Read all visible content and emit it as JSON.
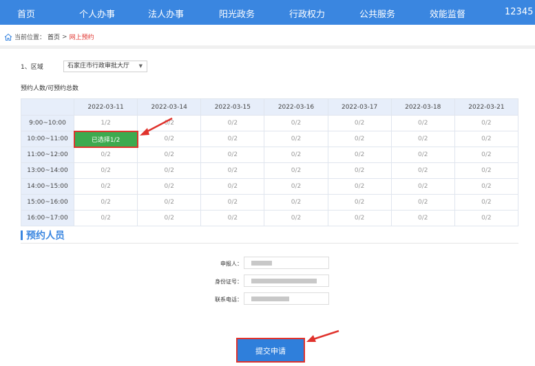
{
  "nav": {
    "items": [
      "首页",
      "个人办事",
      "法人办事",
      "阳光政务",
      "行政权力",
      "公共服务",
      "效能监督",
      "12345"
    ]
  },
  "breadcrumb": {
    "label": "当前位置：",
    "home": "首页",
    "separator": ">",
    "current": "网上预约"
  },
  "region": {
    "label": "1、区域",
    "selected": "石家庄市行政审批大厅"
  },
  "quota_label": "预约人数/可预约总数",
  "schedule": {
    "dates": [
      "2022-03-11",
      "2022-03-14",
      "2022-03-15",
      "2022-03-16",
      "2022-03-17",
      "2022-03-18",
      "2022-03-21"
    ],
    "rows": [
      {
        "time": "9:00~10:00",
        "cells": [
          "1/2",
          "0/2",
          "0/2",
          "0/2",
          "0/2",
          "0/2",
          "0/2"
        ]
      },
      {
        "time": "10:00~11:00",
        "cells": [
          "已选择1/2",
          "0/2",
          "0/2",
          "0/2",
          "0/2",
          "0/2",
          "0/2"
        ]
      },
      {
        "time": "11:00~12:00",
        "cells": [
          "0/2",
          "0/2",
          "0/2",
          "0/2",
          "0/2",
          "0/2",
          "0/2"
        ]
      },
      {
        "time": "13:00~14:00",
        "cells": [
          "0/2",
          "0/2",
          "0/2",
          "0/2",
          "0/2",
          "0/2",
          "0/2"
        ]
      },
      {
        "time": "14:00~15:00",
        "cells": [
          "0/2",
          "0/2",
          "0/2",
          "0/2",
          "0/2",
          "0/2",
          "0/2"
        ]
      },
      {
        "time": "15:00~16:00",
        "cells": [
          "0/2",
          "0/2",
          "0/2",
          "0/2",
          "0/2",
          "0/2",
          "0/2"
        ]
      },
      {
        "time": "16:00~17:00",
        "cells": [
          "0/2",
          "0/2",
          "0/2",
          "0/2",
          "0/2",
          "0/2",
          "0/2"
        ]
      }
    ],
    "selected_row": 1,
    "selected_col": 0
  },
  "section": {
    "title": "预约人员"
  },
  "form": {
    "applicant_label": "申报人：",
    "id_label": "身份证号：",
    "phone_label": "联系电话："
  },
  "submit_label": "提交申请",
  "colors": {
    "primary": "#3a86e0",
    "selected": "#3daa4f",
    "annotation": "#e0322c"
  },
  "icons": {
    "home": "home-icon",
    "dropdown": "chevron-down-icon"
  }
}
